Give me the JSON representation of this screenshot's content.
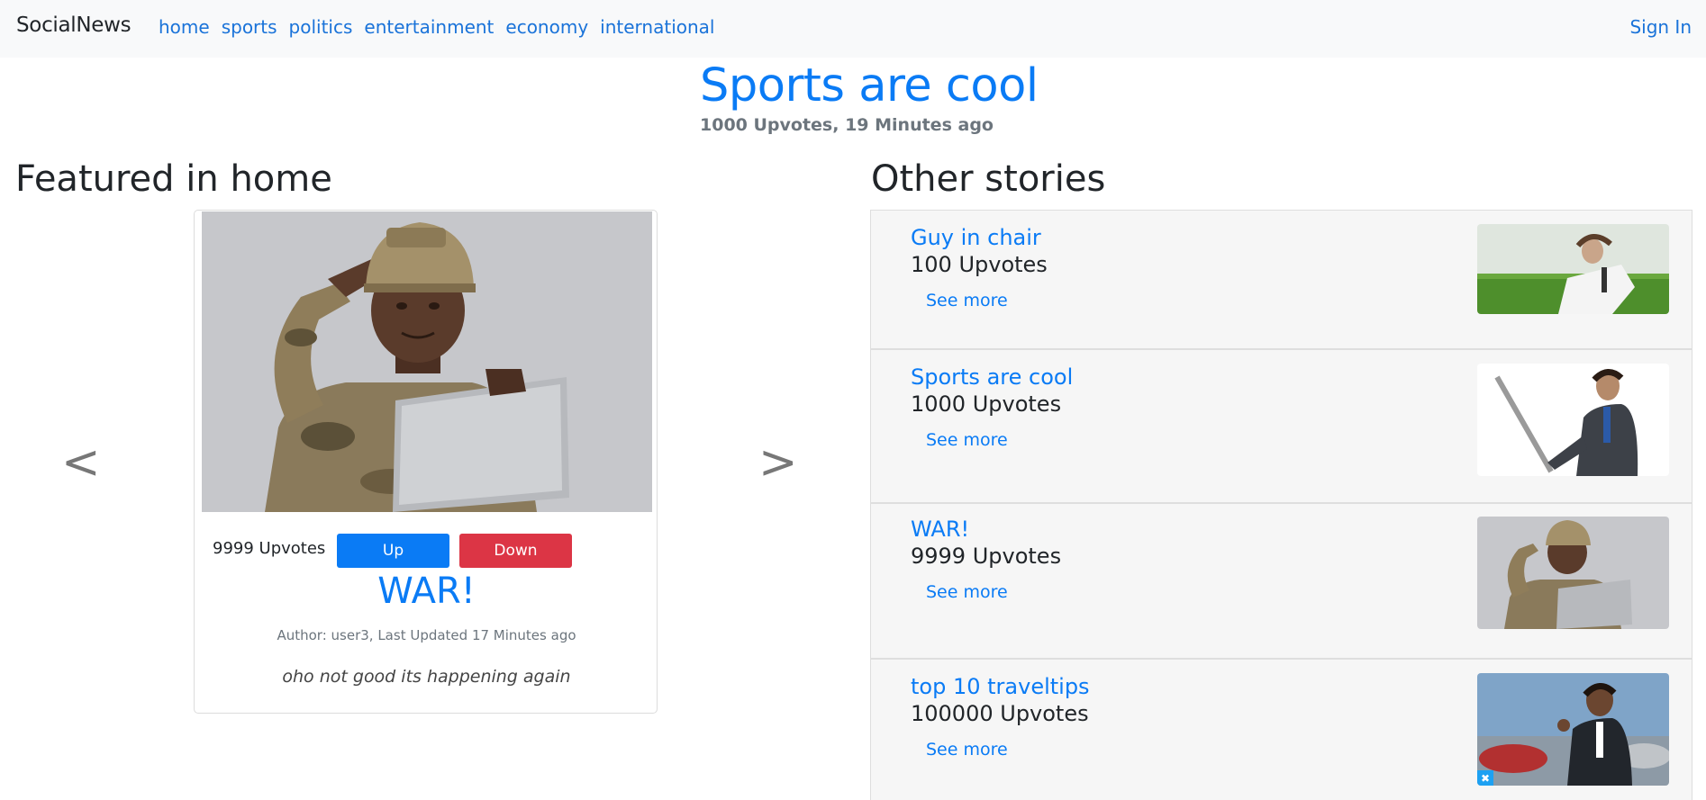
{
  "navbar": {
    "brand": "SocialNews",
    "links": [
      "home",
      "sports",
      "politics",
      "entertainment",
      "economy",
      "international"
    ],
    "sign_in": "Sign In"
  },
  "hero": {
    "title": "Sports are cool",
    "meta": "1000 Upvotes, 19 Minutes ago"
  },
  "featured": {
    "heading": "Featured in home",
    "prev_arrow": "<",
    "next_arrow": ">",
    "card": {
      "upvotes": "9999 Upvotes",
      "up_label": "Up",
      "down_label": "Down",
      "title": "WAR!",
      "author_line": "Author: user3, Last Updated 17 Minutes ago",
      "description": "oho not good its happening again"
    }
  },
  "other": {
    "heading": "Other stories",
    "stories": [
      {
        "title": "Guy in chair",
        "votes": "100 Upvotes",
        "more": "See more"
      },
      {
        "title": "Sports are cool",
        "votes": "1000 Upvotes",
        "more": "See more"
      },
      {
        "title": "WAR!",
        "votes": "9999 Upvotes",
        "more": "See more"
      },
      {
        "title": "top 10 traveltips",
        "votes": "100000 Upvotes",
        "more": "See more"
      }
    ]
  }
}
